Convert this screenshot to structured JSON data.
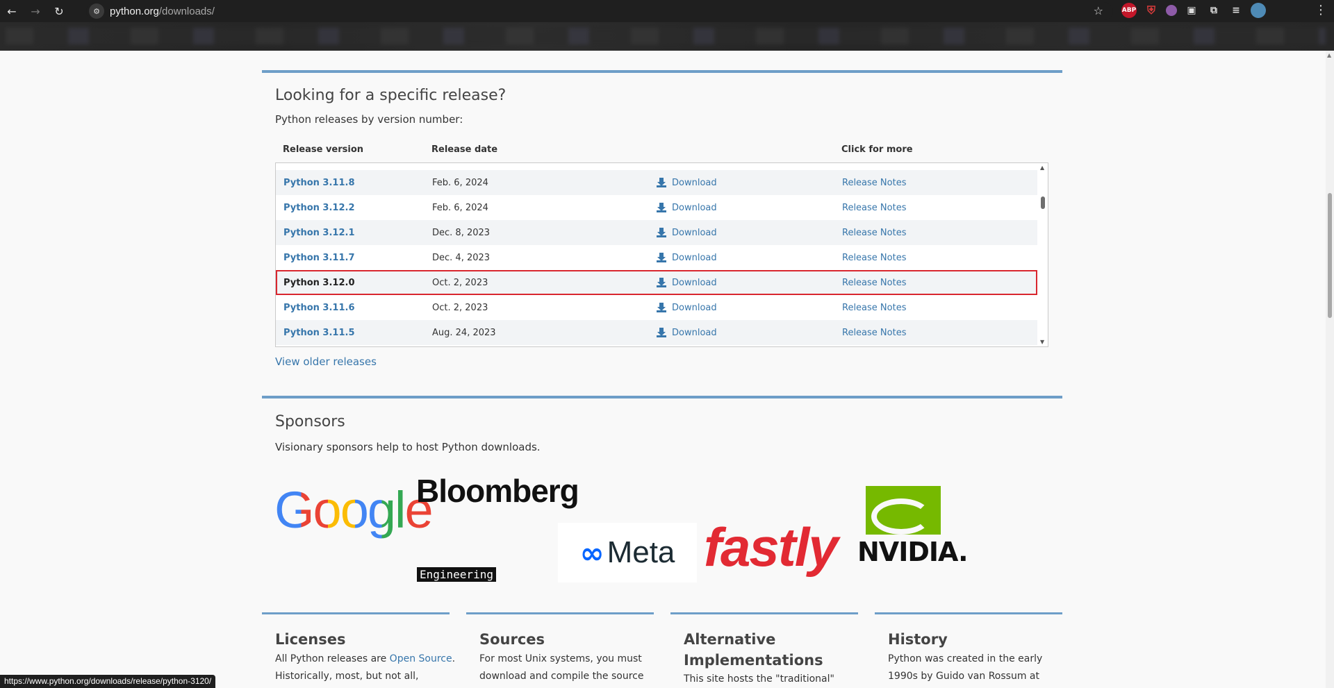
{
  "browser": {
    "url_host": "python.org",
    "url_path": "/downloads/",
    "status_url": "https://www.python.org/downloads/release/python-3120/"
  },
  "specific_release": {
    "heading": "Looking for a specific release?",
    "subheading": "Python releases by version number:",
    "columns": {
      "version": "Release version",
      "date": "Release date",
      "more": "Click for more"
    },
    "rows": [
      {
        "version": "Python 3.11.8",
        "date": "Feb. 6, 2024",
        "download": "Download",
        "notes": "Release Notes"
      },
      {
        "version": "Python 3.12.2",
        "date": "Feb. 6, 2024",
        "download": "Download",
        "notes": "Release Notes"
      },
      {
        "version": "Python 3.12.1",
        "date": "Dec. 8, 2023",
        "download": "Download",
        "notes": "Release Notes"
      },
      {
        "version": "Python 3.11.7",
        "date": "Dec. 4, 2023",
        "download": "Download",
        "notes": "Release Notes"
      },
      {
        "version": "Python 3.12.0",
        "date": "Oct. 2, 2023",
        "download": "Download",
        "notes": "Release Notes"
      },
      {
        "version": "Python 3.11.6",
        "date": "Oct. 2, 2023",
        "download": "Download",
        "notes": "Release Notes"
      },
      {
        "version": "Python 3.11.5",
        "date": "Aug. 24, 2023",
        "download": "Download",
        "notes": "Release Notes"
      }
    ],
    "view_older": "View older releases"
  },
  "sponsors": {
    "heading": "Sponsors",
    "subheading": "Visionary sponsors help to host Python downloads.",
    "logos": {
      "google": "Google",
      "bloomberg": "Bloomberg",
      "bloomberg_sub": "Engineering",
      "meta": "Meta",
      "fastly": "fastly",
      "nvidia": "NVIDIA."
    }
  },
  "footer": {
    "licenses": {
      "title": "Licenses",
      "line1_prefix": "All Python releases are ",
      "line1_link": "Open Source",
      "line1_suffix": ".",
      "line2": "Historically, most, but not all,"
    },
    "sources": {
      "title": "Sources",
      "line1": "For most Unix systems, you must",
      "line2": "download and compile the source"
    },
    "alternative": {
      "title_line1": "Alternative",
      "title_line2": "Implementations",
      "line1": "This site hosts the \"traditional\""
    },
    "history": {
      "title": "History",
      "line1": "Python was created in the early",
      "line2": "1990s by Guido van Rossum at"
    }
  },
  "colors": {
    "accent": "#3776ab",
    "highlight": "#d9262e",
    "rule": "#6e9ec8"
  }
}
